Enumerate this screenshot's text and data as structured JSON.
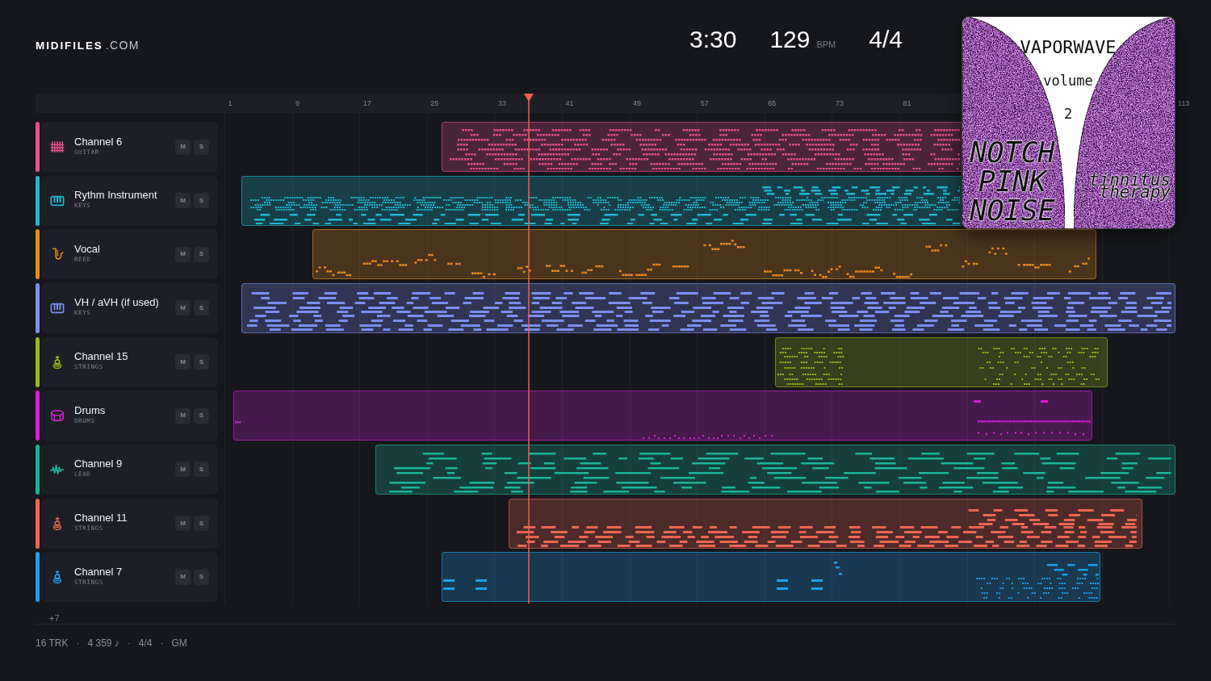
{
  "logo": {
    "name": "MIDIFILES",
    "suffix": ".COM"
  },
  "stats": {
    "duration": "3:30",
    "tempo": "129",
    "tempo_unit": "BPM",
    "meter": "4/4"
  },
  "album_cover": {
    "title": "VAPORWAVE",
    "subtitle": "volume",
    "number": "2",
    "headline": [
      "NOTCH",
      "PINK",
      "NOISE"
    ],
    "tagline": "tinnitus therapy"
  },
  "ruler": {
    "marks": [
      "1",
      "9",
      "17",
      "25",
      "33",
      "41",
      "49",
      "57",
      "65",
      "73",
      "81"
    ],
    "end_mark": "113"
  },
  "playhead": {
    "level": 0.32
  },
  "tracks": [
    {
      "name": "Channel 6",
      "category": "GUITAR",
      "kind": "guitar",
      "color": "#e8508f",
      "mute": {
        "label": "M",
        "on": false
      },
      "solo": {
        "label": "S",
        "on": false
      }
    },
    {
      "name": "Rythm Instrument",
      "category": "KEYS",
      "kind": "keys",
      "color": "#1fb6d0",
      "mute": {
        "label": "M",
        "on": false
      },
      "solo": {
        "label": "S",
        "on": false
      }
    },
    {
      "name": "Vocal",
      "category": "REED",
      "kind": "reed",
      "color": "#e88a1c",
      "mute": {
        "label": "M",
        "on": false
      },
      "solo": {
        "label": "S",
        "on": false
      }
    },
    {
      "name": "VH / aVH (if used)",
      "category": "KEYS",
      "kind": "keys",
      "color": "#7c8ef2",
      "mute": {
        "label": "M",
        "on": false
      },
      "solo": {
        "label": "S",
        "on": false
      }
    },
    {
      "name": "Channel 15",
      "category": "STRINGS",
      "kind": "strings",
      "color": "#9cb81c",
      "mute": {
        "label": "M",
        "on": false
      },
      "solo": {
        "label": "S",
        "on": false
      }
    },
    {
      "name": "Drums",
      "category": "DRUMS",
      "kind": "drums",
      "color": "#d51fd8",
      "mute": {
        "label": "M",
        "on": false
      },
      "solo": {
        "label": "S",
        "on": false
      }
    },
    {
      "name": "Channel 9",
      "category": "LEAD",
      "kind": "lead",
      "color": "#19b59a",
      "mute": {
        "label": "M",
        "on": false
      },
      "solo": {
        "label": "S",
        "on": false
      }
    },
    {
      "name": "Channel 11",
      "category": "STRINGS",
      "kind": "strings",
      "color": "#ee6650",
      "mute": {
        "label": "M",
        "on": false
      },
      "solo": {
        "label": "S",
        "on": false
      }
    },
    {
      "name": "Channel 7",
      "category": "STRINGS",
      "kind": "strings",
      "color": "#1f9fea",
      "mute": {
        "label": "M",
        "on": false
      },
      "solo": {
        "label": "S",
        "on": false
      }
    }
  ],
  "more_tracks": "+7",
  "footer": [
    {
      "kind": "stat",
      "text": "16 TRK"
    },
    {
      "kind": "separator",
      "text": "·"
    },
    {
      "kind": "stat",
      "text": "4 359 ♪"
    },
    {
      "kind": "separator",
      "text": "·"
    },
    {
      "kind": "stat",
      "text": "4/4"
    },
    {
      "kind": "separator",
      "text": "·"
    },
    {
      "kind": "stat",
      "text": "GM"
    }
  ]
}
